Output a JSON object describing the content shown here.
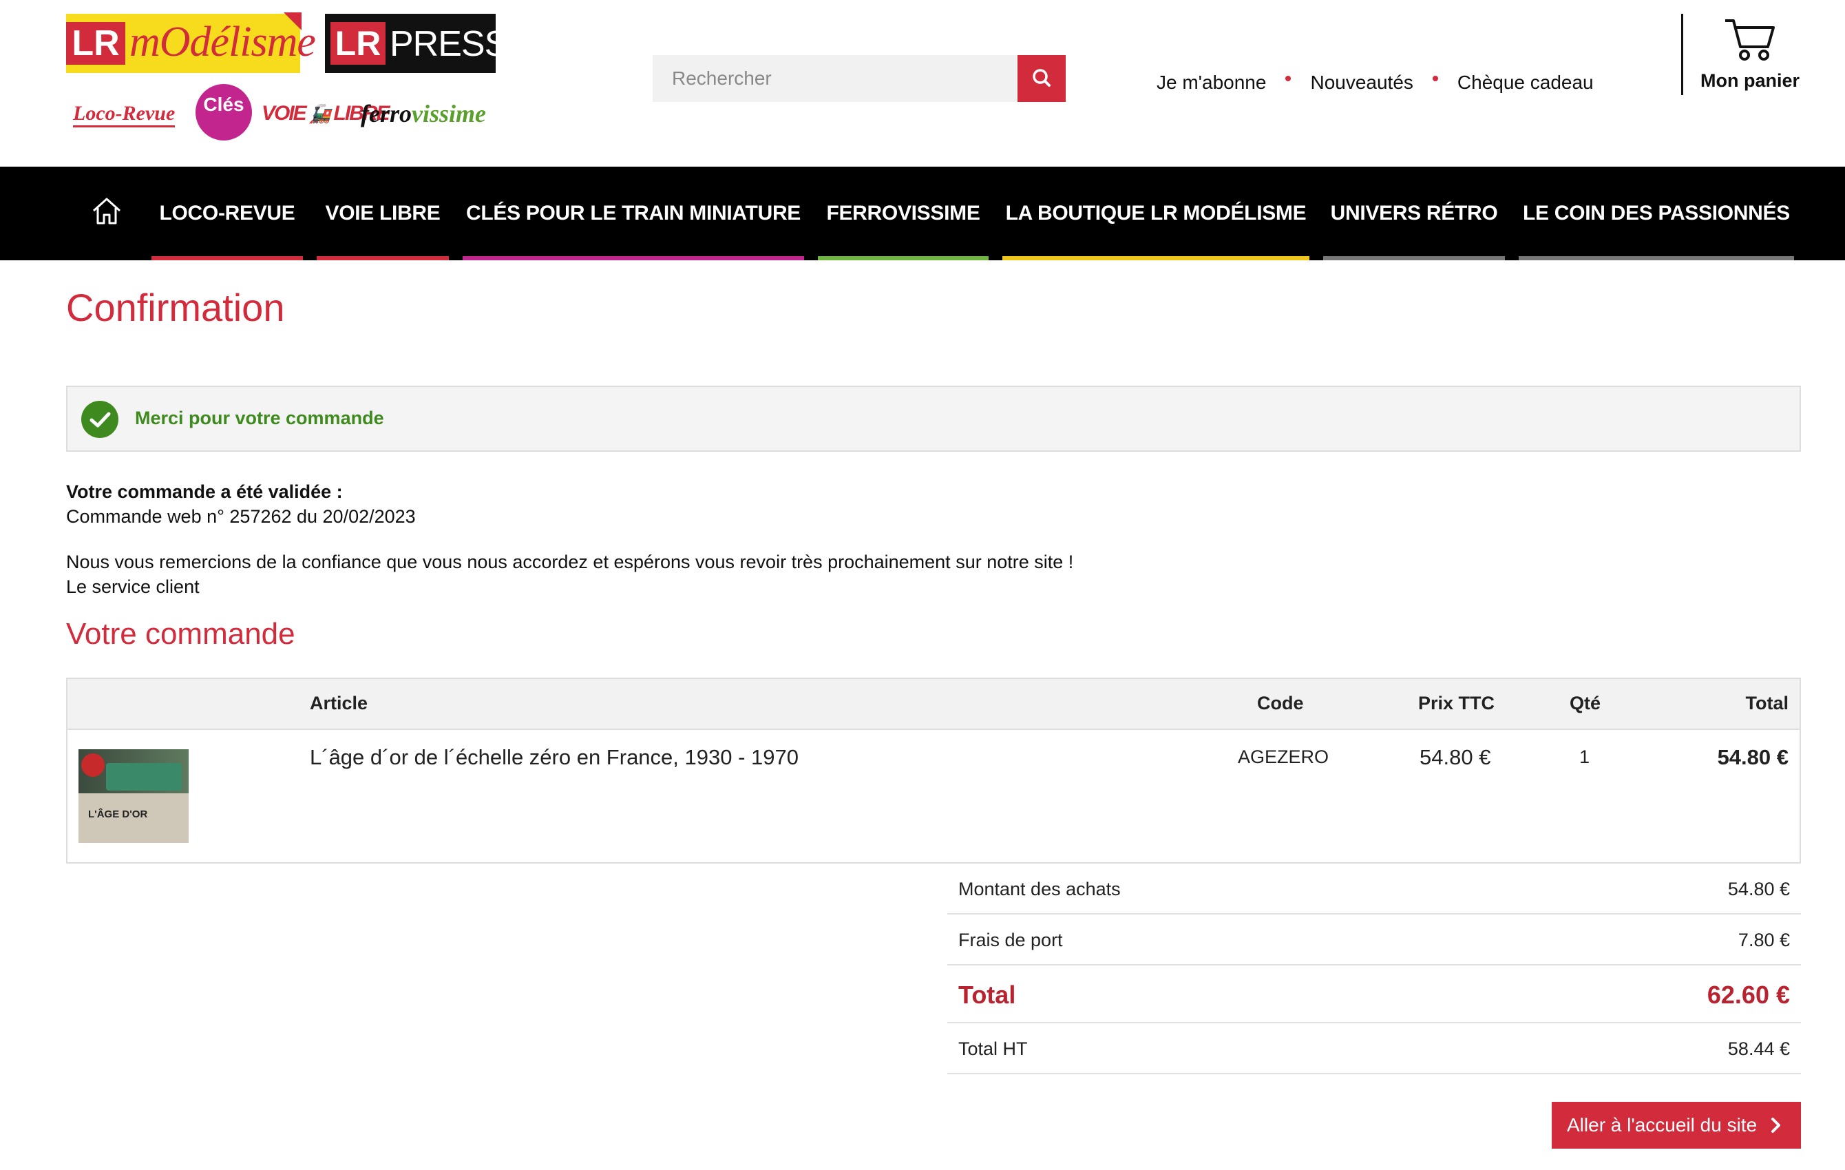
{
  "header": {
    "logo_lrm_lr": "LR",
    "logo_lrm_text": "mOdélisme",
    "logo_presse_lr": "LR",
    "logo_presse_text": "PRESSE",
    "brands": {
      "loco_revue": "Loco-Revue",
      "cles": "Clés",
      "voie_libre_a": "VOIE",
      "voie_libre_b": "LIBRE",
      "ferro_a": "ferro",
      "ferro_b": "vissime"
    },
    "search_placeholder": "Rechercher",
    "links": [
      "Je m'abonne",
      "Nouveautés",
      "Chèque cadeau"
    ],
    "cart_label": "Mon panier"
  },
  "nav": {
    "items": [
      {
        "label": "LOCO-REVUE",
        "color": "#d12b3c"
      },
      {
        "label": "VOIE LIBRE",
        "color": "#d12b3c"
      },
      {
        "label": "CLÉS POUR LE TRAIN MINIATURE",
        "color": "#c3258f"
      },
      {
        "label": "FERROVISSIME",
        "color": "#6fb43f"
      },
      {
        "label": "LA BOUTIQUE LR MODÉLISME",
        "color": "#f0c419"
      },
      {
        "label": "UNIVERS RÉTRO",
        "color": "#777777"
      },
      {
        "label": "LE COIN DES PASSIONNÉS",
        "color": "#777777"
      }
    ]
  },
  "page": {
    "title": "Confirmation",
    "alert": "Merci pour votre commande",
    "validated_label": "Votre commande a été validée :",
    "order_ref": "Commande web n° 257262 du 20/02/2023",
    "thanks": "Nous vous remercions de la confiance que vous nous accordez et espérons vous revoir très prochainement sur notre site !",
    "signature": "Le service client",
    "order_title": "Votre commande"
  },
  "table": {
    "headers": {
      "article": "Article",
      "code": "Code",
      "price": "Prix TTC",
      "qty": "Qté",
      "total": "Total"
    },
    "rows": [
      {
        "article": "L´âge d´or de l´échelle zéro en France, 1930 - 1970",
        "code": "AGEZERO",
        "price": "54.80 €",
        "qty": "1",
        "total": "54.80 €",
        "thumb_title": "L'ÂGE D'OR"
      }
    ]
  },
  "summary": {
    "subtotal_label": "Montant des achats",
    "subtotal": "54.80 €",
    "shipping_label": "Frais de port",
    "shipping": "7.80 €",
    "total_label": "Total",
    "total": "62.60 €",
    "ht_label": "Total HT",
    "ht": "58.44 €"
  },
  "cta": "Aller à l'accueil du site",
  "colors": {
    "accent": "#d12b3c",
    "success": "#3f8a1f"
  }
}
